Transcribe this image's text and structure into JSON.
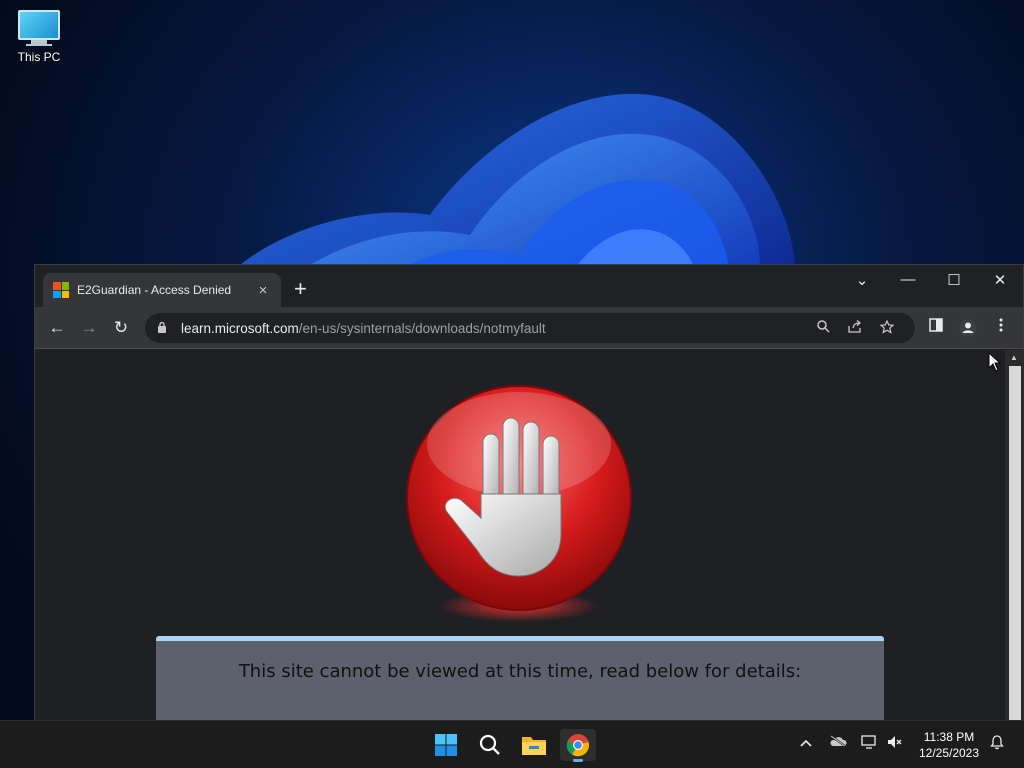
{
  "desktop": {
    "icons": [
      {
        "label": "This PC",
        "icon": "monitor-icon"
      }
    ]
  },
  "browser": {
    "tab": {
      "title": "E2Guardian - Access Denied",
      "favicon": "microsoft-logo-icon",
      "close": "×"
    },
    "new_tab": "+",
    "window_controls": {
      "dropdown": "⌄",
      "minimize": "—",
      "maximize": "☐",
      "close": "✕"
    },
    "nav": {
      "back": "←",
      "forward": "→",
      "reload": "↻"
    },
    "address": {
      "domain": "learn.microsoft.com",
      "path": "/en-us/sysinternals/downloads/notmyfault"
    },
    "omnibox_icons": [
      "zoom-icon",
      "share-icon",
      "bookmark-star-icon"
    ],
    "toolbar_icons": [
      "side-panel-icon",
      "profile-icon",
      "menu-icon"
    ]
  },
  "page": {
    "message": "This site cannot be viewed at this time, read below for details:",
    "image": "stop-hand-icon",
    "colors": {
      "panel_bg": "#5d606d",
      "panel_border": "#a9d6f5",
      "stop_red": "#d61b1b"
    }
  },
  "taskbar": {
    "apps": [
      "start-icon",
      "search-icon",
      "file-explorer-icon",
      "chrome-icon"
    ],
    "active_app": "chrome-icon",
    "tray_icons": [
      "chevron-up-icon",
      "onedrive-offline-icon",
      "network-icon",
      "volume-muted-icon",
      "notification-bell-icon"
    ],
    "time": "11:38 PM",
    "date": "12/25/2023"
  }
}
